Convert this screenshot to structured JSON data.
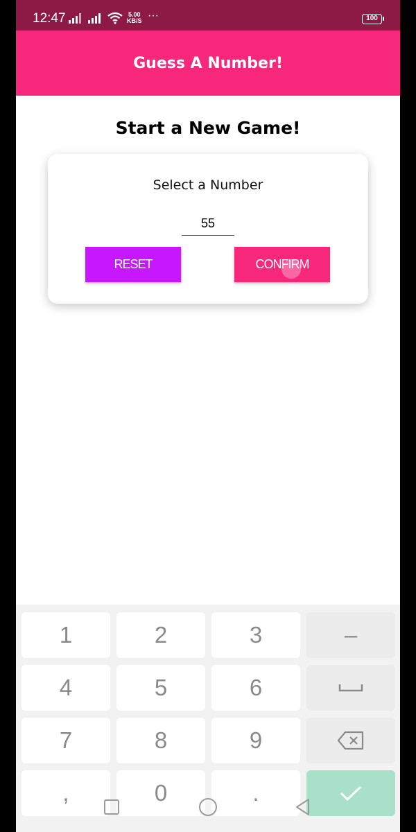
{
  "status_bar": {
    "time": "12:47",
    "speed_value": "5.00",
    "speed_unit": "KB/S",
    "more": "···",
    "battery": "100",
    "icons": [
      "signal-icon",
      "signal-icon",
      "wifi-icon",
      "battery-icon"
    ]
  },
  "header": {
    "title": "Guess A Number!"
  },
  "screen": {
    "title": "Start a New Game!"
  },
  "card": {
    "label": "Select a Number",
    "input_value": "55",
    "reset_label": "RESET",
    "confirm_label": "CONFIRM"
  },
  "keyboard": {
    "rows": [
      [
        "1",
        "2",
        "3",
        "–"
      ],
      [
        "4",
        "5",
        "6",
        "space"
      ],
      [
        "7",
        "8",
        "9",
        "backspace"
      ],
      [
        ",",
        "0",
        ".",
        "enter"
      ]
    ],
    "keys": {
      "k1": "1",
      "k2": "2",
      "k3": "3",
      "k_minus": "–",
      "k4": "4",
      "k5": "5",
      "k6": "6",
      "k7": "7",
      "k8": "8",
      "k9": "9",
      "k_comma": ",",
      "k0": "0",
      "k_dot": "."
    }
  },
  "nav_bar": {
    "buttons": [
      "recents-icon",
      "home-icon",
      "back-icon"
    ]
  },
  "colors": {
    "status_bar": "#8d1a45",
    "primary": "#f7287b",
    "accent": "#c717fc",
    "enter_key": "#a8e0c9"
  }
}
